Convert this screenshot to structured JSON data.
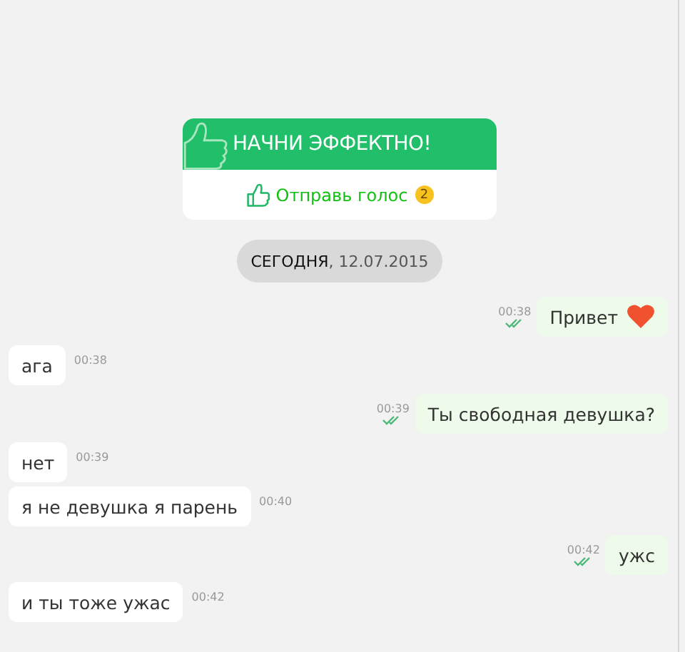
{
  "promo": {
    "title": "НАЧНИ ЭФФЕКТНО!",
    "action": "Отправь голос",
    "badge": "2"
  },
  "date_divider": {
    "day": "СЕГОДНЯ",
    "date": ", 12.07.2015"
  },
  "messages": [
    {
      "kind": "outgoing",
      "text": "Привет",
      "time": "00:38",
      "read": true,
      "heart": true
    },
    {
      "kind": "incoming",
      "text": "ага",
      "time": "00:38"
    },
    {
      "kind": "outgoing",
      "text": "Ты свободная девушка?",
      "time": "00:39",
      "read": true,
      "heart": false
    },
    {
      "kind": "incoming",
      "text": "нет",
      "time": "00:39"
    },
    {
      "kind": "incoming",
      "text": "я не девушка я парень",
      "time": "00:40"
    },
    {
      "kind": "outgoing",
      "text": "ужс",
      "time": "00:42",
      "read": true,
      "heart": false
    },
    {
      "kind": "incoming",
      "text": "и ты тоже ужас",
      "time": "00:42"
    }
  ]
}
